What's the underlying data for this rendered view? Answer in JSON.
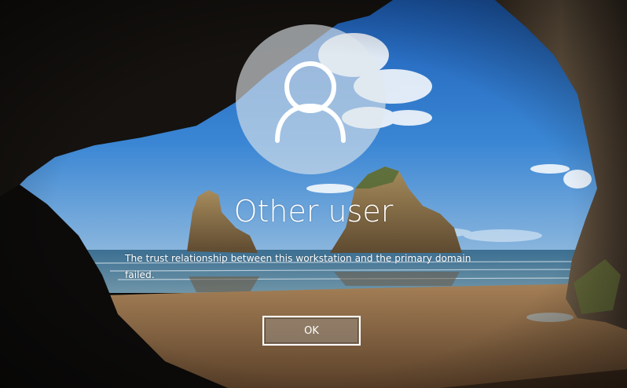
{
  "screen": {
    "user": {
      "name": "Other user",
      "avatar_icon": "user-silhouette-icon"
    },
    "message": "The trust relationship between this workstation and the primary domain failed.",
    "ok_button_label": "OK"
  },
  "colors": {
    "text": "#ffffff",
    "avatar_circle": "#e1e6ec",
    "button_border": "#ffffff",
    "sky": "#2f74c8",
    "sea": "#4a7f9e",
    "sand": "#8a6a4a",
    "cave": "#0b0a09"
  }
}
